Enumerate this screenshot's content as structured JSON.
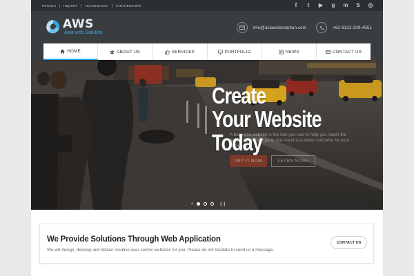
{
  "topbar": {
    "links": [
      "PRICING",
      "INQUIRY",
      "TECHNOLOGY",
      "PARTNERSHIPS"
    ],
    "social": [
      {
        "icon": "facebook-icon",
        "glyph": "f"
      },
      {
        "icon": "twitter-icon",
        "glyph": "t"
      },
      {
        "icon": "youtube-icon",
        "glyph": "▶"
      },
      {
        "icon": "google-plus-icon",
        "glyph": "g"
      },
      {
        "icon": "linkedin-icon",
        "glyph": "in"
      },
      {
        "icon": "skype-icon",
        "glyph": "S"
      },
      {
        "icon": "instagram-icon",
        "glyph": "◎"
      }
    ]
  },
  "header": {
    "logo_text": "AWS",
    "logo_sub": "Asia web Solution",
    "email": "info@asiawebsolution.com",
    "phone": "+62 8131-209-4551"
  },
  "nav": {
    "items": [
      {
        "label": "HOME",
        "icon": "home-icon",
        "active": true
      },
      {
        "label": "ABOUT US",
        "icon": "users-icon",
        "active": false
      },
      {
        "label": "SERVICES",
        "icon": "thumbs-up-icon",
        "active": false
      },
      {
        "label": "PORTFOLIO",
        "icon": "monitor-icon",
        "active": false
      },
      {
        "label": "NEWS",
        "icon": "news-icon",
        "active": false
      },
      {
        "label": "CONTACT US",
        "icon": "envelope-icon",
        "active": false
      }
    ]
  },
  "hero": {
    "title_line1": "Create",
    "title_line2": "Your Website Today",
    "subtitle": "A business website is the tool you use to help you reach the goals of your company, the result is a better outcome for your business.",
    "try_label": "TRY IT NOW",
    "learn_label": "LEARN MORE",
    "slides_total": 3,
    "slide_active": 1
  },
  "cta": {
    "title": "We Provide Solutions Through Web Application",
    "text": "We will design, develop and deliver creative user-centric websites for you. Please do not hesitate to send us a message.",
    "button": "CONTACT US"
  },
  "colors": {
    "accent": "#2ba7e6",
    "topbar": "#2b2f33",
    "header": "#3a3d40"
  }
}
